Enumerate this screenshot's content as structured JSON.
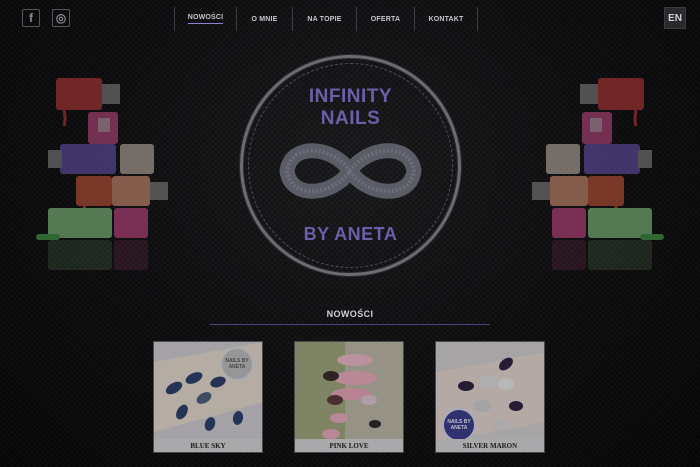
{
  "social": {
    "facebook": "f",
    "instagram": "◎"
  },
  "nav": {
    "items": [
      {
        "label": "NOWOŚCI"
      },
      {
        "label": "O MNIE"
      },
      {
        "label": "NA TOPIE"
      },
      {
        "label": "OFERTA"
      },
      {
        "label": "KONTAKT"
      }
    ]
  },
  "lang": "EN",
  "logo": {
    "line1": "INFINITY",
    "line2": "NAILS",
    "line3": "BY ANETA"
  },
  "section": {
    "title": "NOWOŚCI"
  },
  "cards": [
    {
      "caption": "BLUE SKY"
    },
    {
      "caption": "PINK LOVE"
    },
    {
      "caption": "SILVER MARON"
    }
  ],
  "badge": {
    "top": "NAILS BY",
    "bottom": "ANETA"
  },
  "colors": {
    "accent": "#6a5fa8",
    "background": "#0b0b0c",
    "divider": "#4a4380"
  }
}
